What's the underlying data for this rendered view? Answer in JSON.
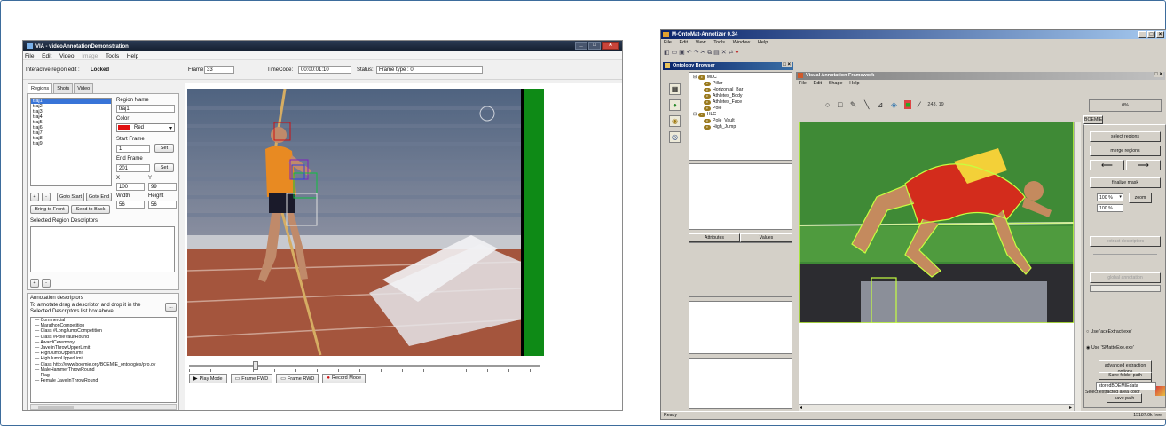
{
  "left_window": {
    "title": "VIA - videoAnnotationDemonstration",
    "menu": [
      "File",
      "Edit",
      "Video",
      "Image",
      "Tools",
      "Help"
    ],
    "menu_disabled": [
      "Image"
    ],
    "interactive_edit_label": "Interactive region edit :",
    "interactive_edit_value": "Locked",
    "frame_label": "Frame:",
    "frame_value": "33",
    "timecode_label": "TimeCode:",
    "timecode_value": "00:00:01:10",
    "status_label": "Status:",
    "status_value": "Frame type : 0",
    "tabs": [
      "Regions",
      "Shots",
      "Video"
    ],
    "regions": [
      "traj1",
      "traj2",
      "traj3",
      "traj4",
      "traj5",
      "traj6",
      "traj7",
      "traj8",
      "traj9"
    ],
    "selected_region": "traj1",
    "region_name_label": "Region Name",
    "region_name_value": "traj1",
    "color_label": "Color",
    "color_value": "Red",
    "color_swatch": "#e01010",
    "start_frame_label": "Start Frame",
    "start_frame_value": "1",
    "set_label": "Set",
    "end_frame_label": "End Frame",
    "end_frame_value": "201",
    "x_label": "X",
    "x_value": "100",
    "y_label": "Y",
    "y_value": "99",
    "width_label": "Width",
    "width_value": "56",
    "height_label": "Height",
    "height_value": "56",
    "plus_label": "+",
    "minus_label": "-",
    "goto_start_label": "Goto Start",
    "goto_end_label": "Goto End",
    "bring_front_label": "Bring to Front",
    "send_back_label": "Send to Back",
    "selected_descriptors_label": "Selected Region Descriptors",
    "annotation_descriptors_label": "Annotation descriptors",
    "annotation_hint": "To annotate drag a descriptor and drop it in the Selected Descriptors list box above.",
    "ellipsis_label": "...",
    "descriptors": [
      "Commercial",
      "MarathonCompetition",
      "Class #LongJumpCompetition",
      "Class #PoleVaultRound",
      "AwardCeremony",
      "JavelinThrowUpperLimit",
      "HighJumpUpperLimit",
      "HighJumpUpperLimit",
      "Class http://www.boemie.org/BOEMIE_ontologies/pro.ov",
      "MaleHammerThrowRound",
      "Flag",
      "Female JavelinThrowRound"
    ],
    "controls": [
      {
        "icon": "▶",
        "label": "Play Mode"
      },
      {
        "icon": "▭",
        "label": "Frame FWD"
      },
      {
        "icon": "▭",
        "label": "Frame RWD"
      },
      {
        "icon": "●",
        "label": "Record Mode"
      }
    ]
  },
  "right_window": {
    "title": "M-OntoMat-Annotizer 0.34",
    "menu": [
      "File",
      "Edit",
      "View",
      "Tools",
      "Window",
      "Help"
    ],
    "ontology_browser_title": "Ontology Browser",
    "visual_annotation_title": "Visual Annotation Framework",
    "visual_menu": [
      "File",
      "Edit",
      "Shape",
      "Help"
    ],
    "coords": "243, 19",
    "ontology_tree": [
      {
        "level": 0,
        "name": "MLC"
      },
      {
        "level": 1,
        "name": "Pillar"
      },
      {
        "level": 1,
        "name": "Horizontal_Bar"
      },
      {
        "level": 1,
        "name": "Athletes_Body"
      },
      {
        "level": 1,
        "name": "Athletes_Face"
      },
      {
        "level": 1,
        "name": "Pole"
      },
      {
        "level": 0,
        "name": "HLC"
      },
      {
        "level": 1,
        "name": "Pole_Vault"
      },
      {
        "level": 1,
        "name": "High_Jump"
      }
    ],
    "attributes_header": "Attributes",
    "values_header": "Values",
    "progress_label": "0%",
    "progress_value": 0,
    "boemie_tab": "BOEMIE",
    "select_regions_label": "select regions",
    "merge_regions_label": "merge regions",
    "finalize_mask_label": "finalize mask",
    "zoom_select": "100 %",
    "zoom_label": "zoom",
    "zoom_value": "100 %",
    "extract_descriptors_label": "extract descriptors",
    "global_annotation_label": "global annotation",
    "radio_ace_label": "Use 'aceExtract.exe'",
    "radio_ace_selected": false,
    "radio_smatte_label": "Use 'SMatteExe.exe'",
    "radio_smatte_selected": true,
    "advanced_options_label": "advanced extraction options",
    "area_color_label": "Select extracted area color",
    "save_folder_label": "Save folder path",
    "save_folder_value": "storedBOEMIEdata",
    "save_path_label": "save path",
    "status_left": "Ready",
    "status_right": "15187.0k free"
  }
}
